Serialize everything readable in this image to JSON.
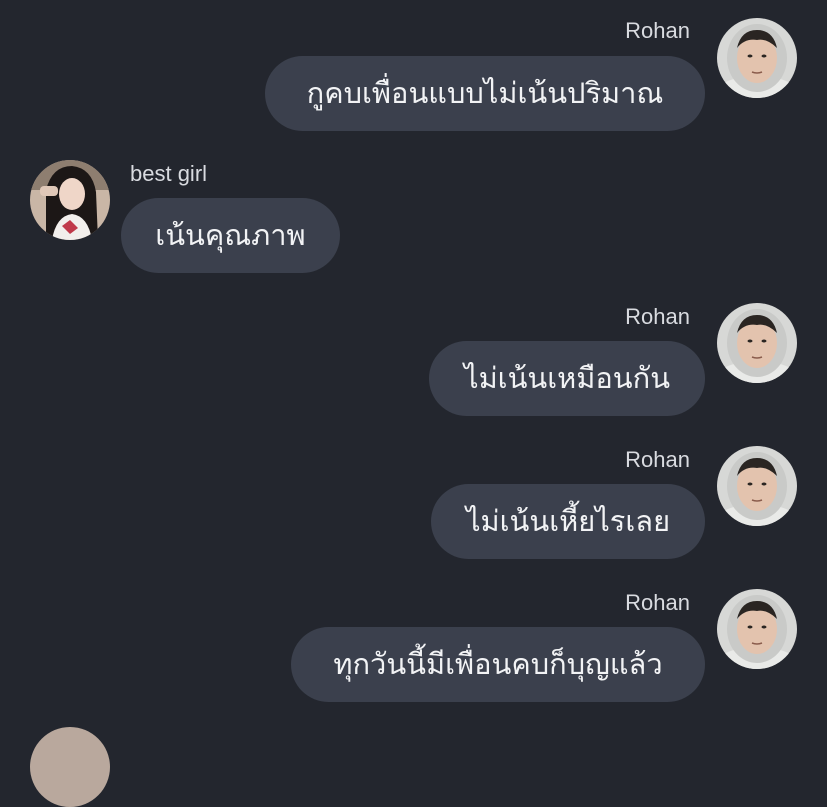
{
  "conversation": {
    "messages": [
      {
        "sender": "Rohan",
        "text": "กูคบเพื่อนแบบไม่เน้นปริมาณ",
        "direction": "outgoing",
        "avatar": "avatar-rohan"
      },
      {
        "sender": "best girl",
        "text": "เน้นคุณภาพ",
        "direction": "incoming",
        "avatar": "avatar-best-girl"
      },
      {
        "sender": "Rohan",
        "text": "ไม่เน้นเหมือนกัน",
        "direction": "outgoing",
        "avatar": "avatar-rohan"
      },
      {
        "sender": "Rohan",
        "text": "ไม่เน้นเหี้ยไรเลย",
        "direction": "outgoing",
        "avatar": "avatar-rohan"
      },
      {
        "sender": "Rohan",
        "text": "ทุกวันนี้มีเพื่อนคบก็บุญแล้ว",
        "direction": "outgoing",
        "avatar": "avatar-rohan"
      }
    ]
  },
  "colors": {
    "background": "#23262e",
    "bubble": "#3b404d",
    "bubble_text": "#f2f3f5",
    "sender_text": "#d9dbe0"
  }
}
